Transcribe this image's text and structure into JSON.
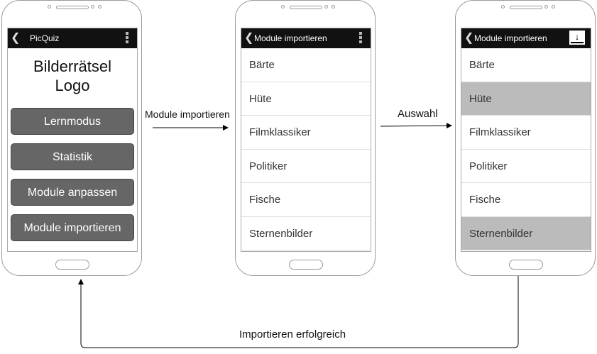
{
  "phone1": {
    "title": "PicQuiz",
    "logo_line1": "Bilderrätsel",
    "logo_line2": "Logo",
    "buttons": [
      "Lernmodus",
      "Statistik",
      "Module anpassen",
      "Module importieren"
    ]
  },
  "phone2": {
    "title": "Module importieren",
    "items": [
      "Bärte",
      "Hüte",
      "Filmklassiker",
      "Politiker",
      "Fische",
      "Sternenbilder"
    ]
  },
  "phone3": {
    "title": "Module importieren",
    "items": [
      "Bärte",
      "Hüte",
      "Filmklassiker",
      "Politiker",
      "Fische",
      "Sternenbilder"
    ],
    "selected": [
      "Hüte",
      "Sternenbilder"
    ]
  },
  "edges": {
    "import": "Module importieren",
    "select": "Auswahl",
    "success": "Importieren erfolgreich"
  },
  "icons": {
    "back": "chevron-left-icon",
    "menu": "kebab-menu-icon",
    "download": "download-icon"
  },
  "colors": {
    "app_bar": "#111111",
    "button": "#666666",
    "selected_item": "#bbbbbb"
  }
}
